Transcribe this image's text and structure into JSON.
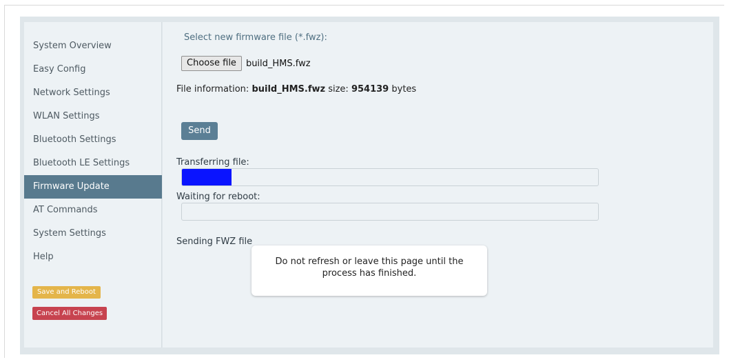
{
  "sidebar": {
    "items": [
      {
        "label": "System Overview",
        "active": false
      },
      {
        "label": "Easy Config",
        "active": false
      },
      {
        "label": "Network Settings",
        "active": false
      },
      {
        "label": "WLAN Settings",
        "active": false
      },
      {
        "label": "Bluetooth Settings",
        "active": false
      },
      {
        "label": "Bluetooth LE Settings",
        "active": false
      },
      {
        "label": "Firmware Update",
        "active": true
      },
      {
        "label": "AT Commands",
        "active": false
      },
      {
        "label": "System Settings",
        "active": false
      },
      {
        "label": "Help",
        "active": false
      }
    ],
    "save_label": "Save and Reboot",
    "cancel_label": "Cancel All Changes",
    "active_color": "#587a8e",
    "save_color": "#e4b54a",
    "cancel_color": "#c7434f"
  },
  "firmware": {
    "select_label": "Select new firmware file (*.fwz):",
    "choose_label": "Choose file",
    "file_name": "build_HMS.fwz",
    "info_prefix": "File information:",
    "info_file": "build_HMS.fwz",
    "info_size_label": "size:",
    "info_size": "954139",
    "info_unit": "bytes",
    "send_label": "Send",
    "transfer_label": "Transferring file:",
    "transfer_progress": 0.12,
    "transfer_color": "#0a14ff",
    "reboot_label": "Waiting for reboot:",
    "reboot_progress": 0,
    "status_text": "Sending FWZ file"
  },
  "modal": {
    "message": "Do not refresh or leave this page until the process has finished."
  }
}
